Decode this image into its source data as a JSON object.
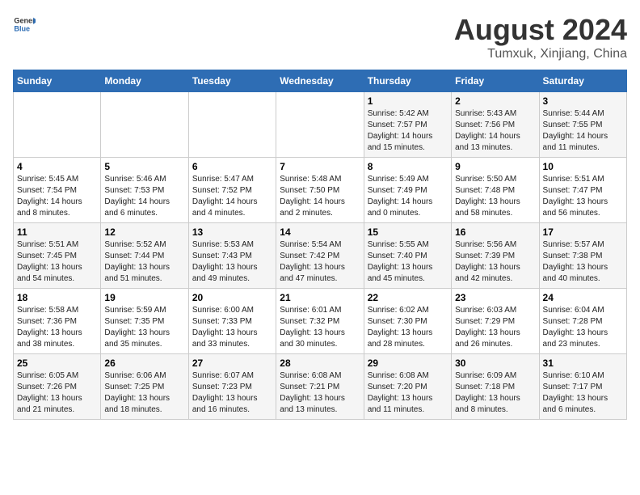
{
  "header": {
    "logo_general": "General",
    "logo_blue": "Blue",
    "title": "August 2024",
    "subtitle": "Tumxuk, Xinjiang, China"
  },
  "calendar": {
    "days_of_week": [
      "Sunday",
      "Monday",
      "Tuesday",
      "Wednesday",
      "Thursday",
      "Friday",
      "Saturday"
    ],
    "weeks": [
      [
        {
          "day": "",
          "detail": ""
        },
        {
          "day": "",
          "detail": ""
        },
        {
          "day": "",
          "detail": ""
        },
        {
          "day": "",
          "detail": ""
        },
        {
          "day": "1",
          "detail": "Sunrise: 5:42 AM\nSunset: 7:57 PM\nDaylight: 14 hours\nand 15 minutes."
        },
        {
          "day": "2",
          "detail": "Sunrise: 5:43 AM\nSunset: 7:56 PM\nDaylight: 14 hours\nand 13 minutes."
        },
        {
          "day": "3",
          "detail": "Sunrise: 5:44 AM\nSunset: 7:55 PM\nDaylight: 14 hours\nand 11 minutes."
        }
      ],
      [
        {
          "day": "4",
          "detail": "Sunrise: 5:45 AM\nSunset: 7:54 PM\nDaylight: 14 hours\nand 8 minutes."
        },
        {
          "day": "5",
          "detail": "Sunrise: 5:46 AM\nSunset: 7:53 PM\nDaylight: 14 hours\nand 6 minutes."
        },
        {
          "day": "6",
          "detail": "Sunrise: 5:47 AM\nSunset: 7:52 PM\nDaylight: 14 hours\nand 4 minutes."
        },
        {
          "day": "7",
          "detail": "Sunrise: 5:48 AM\nSunset: 7:50 PM\nDaylight: 14 hours\nand 2 minutes."
        },
        {
          "day": "8",
          "detail": "Sunrise: 5:49 AM\nSunset: 7:49 PM\nDaylight: 14 hours\nand 0 minutes."
        },
        {
          "day": "9",
          "detail": "Sunrise: 5:50 AM\nSunset: 7:48 PM\nDaylight: 13 hours\nand 58 minutes."
        },
        {
          "day": "10",
          "detail": "Sunrise: 5:51 AM\nSunset: 7:47 PM\nDaylight: 13 hours\nand 56 minutes."
        }
      ],
      [
        {
          "day": "11",
          "detail": "Sunrise: 5:51 AM\nSunset: 7:45 PM\nDaylight: 13 hours\nand 54 minutes."
        },
        {
          "day": "12",
          "detail": "Sunrise: 5:52 AM\nSunset: 7:44 PM\nDaylight: 13 hours\nand 51 minutes."
        },
        {
          "day": "13",
          "detail": "Sunrise: 5:53 AM\nSunset: 7:43 PM\nDaylight: 13 hours\nand 49 minutes."
        },
        {
          "day": "14",
          "detail": "Sunrise: 5:54 AM\nSunset: 7:42 PM\nDaylight: 13 hours\nand 47 minutes."
        },
        {
          "day": "15",
          "detail": "Sunrise: 5:55 AM\nSunset: 7:40 PM\nDaylight: 13 hours\nand 45 minutes."
        },
        {
          "day": "16",
          "detail": "Sunrise: 5:56 AM\nSunset: 7:39 PM\nDaylight: 13 hours\nand 42 minutes."
        },
        {
          "day": "17",
          "detail": "Sunrise: 5:57 AM\nSunset: 7:38 PM\nDaylight: 13 hours\nand 40 minutes."
        }
      ],
      [
        {
          "day": "18",
          "detail": "Sunrise: 5:58 AM\nSunset: 7:36 PM\nDaylight: 13 hours\nand 38 minutes."
        },
        {
          "day": "19",
          "detail": "Sunrise: 5:59 AM\nSunset: 7:35 PM\nDaylight: 13 hours\nand 35 minutes."
        },
        {
          "day": "20",
          "detail": "Sunrise: 6:00 AM\nSunset: 7:33 PM\nDaylight: 13 hours\nand 33 minutes."
        },
        {
          "day": "21",
          "detail": "Sunrise: 6:01 AM\nSunset: 7:32 PM\nDaylight: 13 hours\nand 30 minutes."
        },
        {
          "day": "22",
          "detail": "Sunrise: 6:02 AM\nSunset: 7:30 PM\nDaylight: 13 hours\nand 28 minutes."
        },
        {
          "day": "23",
          "detail": "Sunrise: 6:03 AM\nSunset: 7:29 PM\nDaylight: 13 hours\nand 26 minutes."
        },
        {
          "day": "24",
          "detail": "Sunrise: 6:04 AM\nSunset: 7:28 PM\nDaylight: 13 hours\nand 23 minutes."
        }
      ],
      [
        {
          "day": "25",
          "detail": "Sunrise: 6:05 AM\nSunset: 7:26 PM\nDaylight: 13 hours\nand 21 minutes."
        },
        {
          "day": "26",
          "detail": "Sunrise: 6:06 AM\nSunset: 7:25 PM\nDaylight: 13 hours\nand 18 minutes."
        },
        {
          "day": "27",
          "detail": "Sunrise: 6:07 AM\nSunset: 7:23 PM\nDaylight: 13 hours\nand 16 minutes."
        },
        {
          "day": "28",
          "detail": "Sunrise: 6:08 AM\nSunset: 7:21 PM\nDaylight: 13 hours\nand 13 minutes."
        },
        {
          "day": "29",
          "detail": "Sunrise: 6:08 AM\nSunset: 7:20 PM\nDaylight: 13 hours\nand 11 minutes."
        },
        {
          "day": "30",
          "detail": "Sunrise: 6:09 AM\nSunset: 7:18 PM\nDaylight: 13 hours\nand 8 minutes."
        },
        {
          "day": "31",
          "detail": "Sunrise: 6:10 AM\nSunset: 7:17 PM\nDaylight: 13 hours\nand 6 minutes."
        }
      ]
    ]
  }
}
